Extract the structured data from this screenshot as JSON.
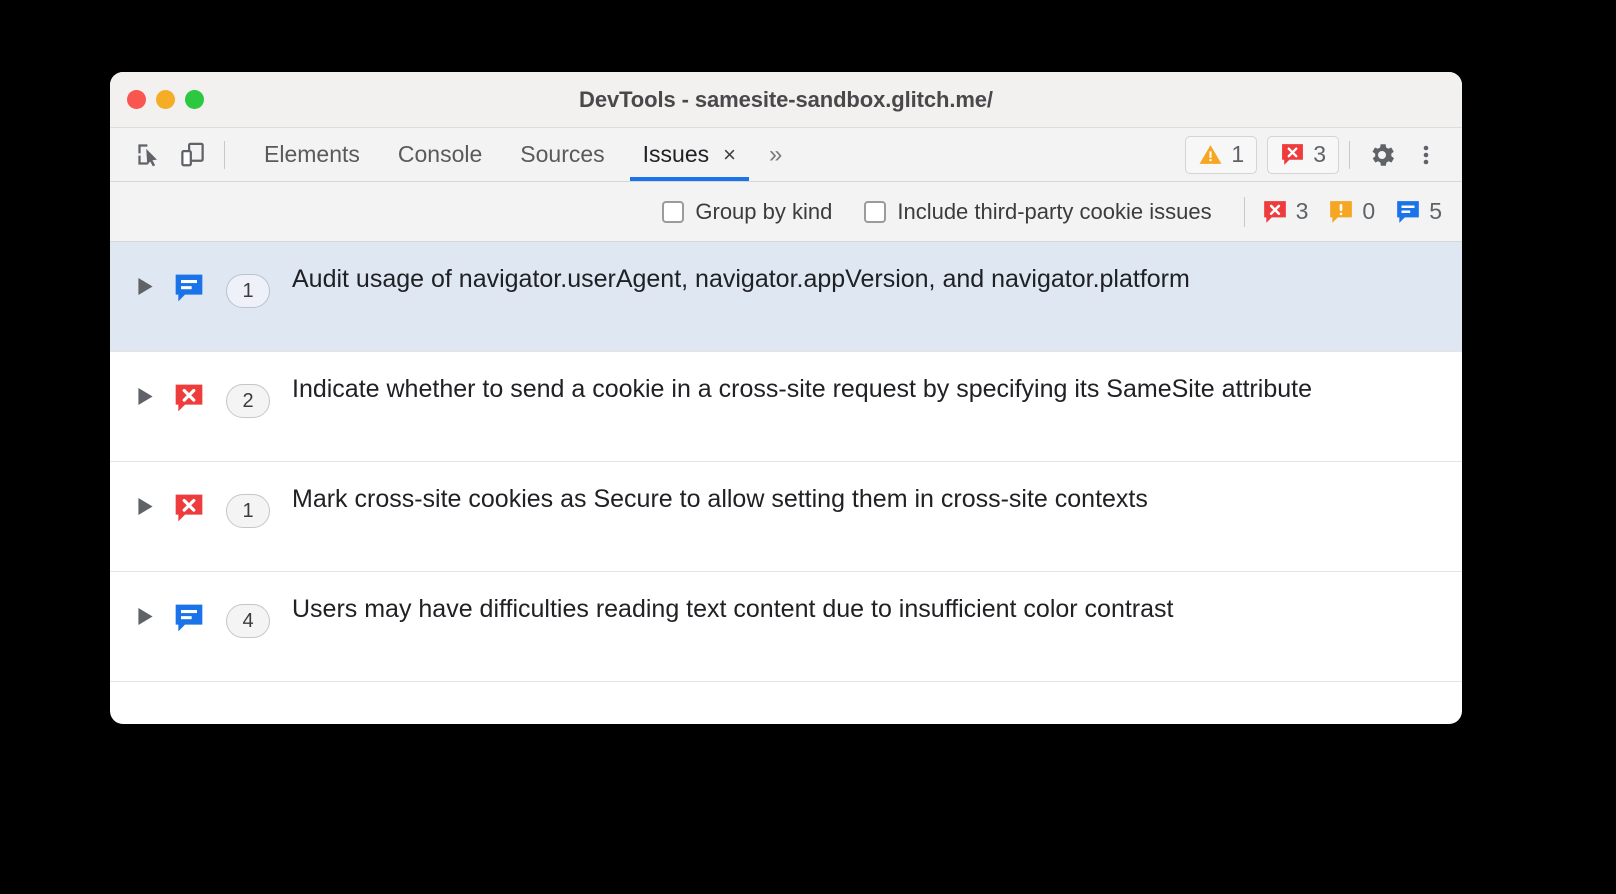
{
  "window": {
    "title": "DevTools - samesite-sandbox.glitch.me/",
    "traffic_lights": [
      "close-red",
      "minimize-yellow",
      "maximize-green"
    ]
  },
  "toolbar": {
    "inspect_icon": "inspect-element-icon",
    "device_icon": "device-toolbar-icon",
    "tabs": [
      {
        "label": "Elements",
        "active": false
      },
      {
        "label": "Console",
        "active": false
      },
      {
        "label": "Sources",
        "active": false
      },
      {
        "label": "Issues",
        "active": true,
        "closable": true
      }
    ],
    "close_glyph": "×",
    "more_tabs_glyph": "»",
    "warning_count": "1",
    "error_count": "3",
    "settings_icon": "gear-icon",
    "more_options_icon": "kebab-menu-icon"
  },
  "filters": {
    "checkboxes": [
      {
        "label": "Group by kind",
        "checked": false
      },
      {
        "label": "Include third-party cookie issues",
        "checked": false
      }
    ],
    "stats": [
      {
        "kind": "error",
        "icon": "error-bubble-icon",
        "count": "3"
      },
      {
        "kind": "warning",
        "icon": "warning-bubble-icon",
        "count": "0"
      },
      {
        "kind": "info",
        "icon": "info-bubble-icon",
        "count": "5"
      }
    ]
  },
  "issues": [
    {
      "severity": "info",
      "icon": "info-bubble-icon",
      "count": "1",
      "title": "Audit usage of navigator.userAgent, navigator.appVersion, and navigator.platform",
      "selected": true,
      "expanded": false
    },
    {
      "severity": "error",
      "icon": "error-bubble-icon",
      "count": "2",
      "title": "Indicate whether to send a cookie in a cross-site request by specifying its SameSite attribute",
      "selected": false,
      "expanded": false
    },
    {
      "severity": "error",
      "icon": "error-bubble-icon",
      "count": "1",
      "title": "Mark cross-site cookies as Secure to allow setting them in cross-site contexts",
      "selected": false,
      "expanded": false
    },
    {
      "severity": "info",
      "icon": "info-bubble-icon",
      "count": "4",
      "title": "Users may have difficulties reading text content due to insufficient color contrast",
      "selected": false,
      "expanded": false
    }
  ],
  "colors": {
    "error_red": "#ee3b3b",
    "warning_yellow": "#f5a623",
    "info_blue": "#1a73e8",
    "tab_underline": "#1a73e8",
    "selected_row": "#dfe7f3",
    "titlebar_bg": "#f2f1f0",
    "toolbar_bg": "#f3f3f3"
  }
}
